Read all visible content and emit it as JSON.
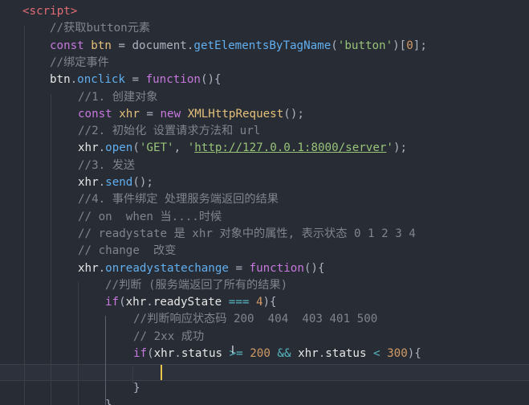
{
  "editor": {
    "lines": [
      {
        "tokens": [
          [
            "tag",
            "<script"
          ],
          [
            "tag",
            ">"
          ]
        ]
      },
      {
        "tokens": [
          [
            "cmt",
            "//获取button元素"
          ]
        ]
      },
      {
        "tokens": [
          [
            "kw",
            "const"
          ],
          [
            "plain",
            " "
          ],
          [
            "var",
            "btn"
          ],
          [
            "plain",
            " = "
          ],
          [
            "plain",
            "document"
          ],
          [
            "plain",
            "."
          ],
          [
            "fn",
            "getElementsByTagName"
          ],
          [
            "plain",
            "("
          ],
          [
            "str",
            "'button'"
          ],
          [
            "plain",
            ")["
          ],
          [
            "num",
            "0"
          ],
          [
            "plain",
            "];"
          ]
        ]
      },
      {
        "tokens": [
          [
            "cmt",
            "//绑定事件"
          ]
        ]
      },
      {
        "tokens": [
          [
            "txt",
            "btn"
          ],
          [
            "plain",
            "."
          ],
          [
            "fn",
            "onclick"
          ],
          [
            "plain",
            " = "
          ],
          [
            "kw",
            "function"
          ],
          [
            "plain",
            "(){"
          ]
        ]
      },
      {
        "tokens": [
          [
            "cmt",
            "//1. 创建对象"
          ]
        ]
      },
      {
        "tokens": [
          [
            "kw",
            "const"
          ],
          [
            "plain",
            " "
          ],
          [
            "var",
            "xhr"
          ],
          [
            "plain",
            " = "
          ],
          [
            "kw",
            "new"
          ],
          [
            "plain",
            " "
          ],
          [
            "cls",
            "XMLHttpRequest"
          ],
          [
            "plain",
            "();"
          ]
        ]
      },
      {
        "tokens": [
          [
            "cmt",
            "//2. 初始化 设置请求方法和 url"
          ]
        ]
      },
      {
        "tokens": [
          [
            "txt",
            "xhr"
          ],
          [
            "plain",
            "."
          ],
          [
            "fn",
            "open"
          ],
          [
            "plain",
            "("
          ],
          [
            "str",
            "'GET'"
          ],
          [
            "plain",
            ", "
          ],
          [
            "str",
            "'"
          ],
          [
            "url",
            "http://127.0.0.1:8000/server"
          ],
          [
            "str",
            "'"
          ],
          [
            "plain",
            ");"
          ]
        ]
      },
      {
        "tokens": [
          [
            "cmt",
            "//3. 发送"
          ]
        ]
      },
      {
        "tokens": [
          [
            "txt",
            "xhr"
          ],
          [
            "plain",
            "."
          ],
          [
            "fn",
            "send"
          ],
          [
            "plain",
            "();"
          ]
        ]
      },
      {
        "tokens": [
          [
            "cmt",
            "//4. 事件绑定 处理服务端返回的结果"
          ]
        ]
      },
      {
        "tokens": [
          [
            "cmt",
            "// on  when 当....时候"
          ]
        ]
      },
      {
        "tokens": [
          [
            "cmt",
            "// readystate 是 xhr 对象中的属性, 表示状态 0 1 2 3 4"
          ]
        ]
      },
      {
        "tokens": [
          [
            "cmt",
            "// change  改变"
          ]
        ]
      },
      {
        "tokens": [
          [
            "txt",
            "xhr"
          ],
          [
            "plain",
            "."
          ],
          [
            "fn",
            "onreadystatechange"
          ],
          [
            "plain",
            " = "
          ],
          [
            "kw",
            "function"
          ],
          [
            "plain",
            "(){"
          ]
        ]
      },
      {
        "tokens": [
          [
            "cmt",
            "//判断 (服务端返回了所有的结果)"
          ]
        ]
      },
      {
        "tokens": [
          [
            "kw",
            "if"
          ],
          [
            "plain",
            "("
          ],
          [
            "txt",
            "xhr"
          ],
          [
            "plain",
            "."
          ],
          [
            "txt",
            "readyState"
          ],
          [
            "plain",
            " "
          ],
          [
            "op",
            "==="
          ],
          [
            "plain",
            " "
          ],
          [
            "num",
            "4"
          ],
          [
            "plain",
            "){"
          ]
        ]
      },
      {
        "tokens": [
          [
            "cmt",
            "//判断响应状态码 200  404  403 401 500"
          ]
        ]
      },
      {
        "tokens": [
          [
            "cmt",
            "// 2xx 成功"
          ]
        ]
      },
      {
        "tokens": [
          [
            "kw",
            "if"
          ],
          [
            "plain",
            "("
          ],
          [
            "txt",
            "xhr"
          ],
          [
            "plain",
            "."
          ],
          [
            "txt",
            "status"
          ],
          [
            "plain",
            " "
          ],
          [
            "op",
            ">="
          ],
          [
            "plain",
            " "
          ],
          [
            "num",
            "200"
          ],
          [
            "plain",
            " "
          ],
          [
            "op",
            "&&"
          ],
          [
            "plain",
            " "
          ],
          [
            "txt",
            "xhr"
          ],
          [
            "plain",
            "."
          ],
          [
            "txt",
            "status"
          ],
          [
            "plain",
            " "
          ],
          [
            "op",
            "<"
          ],
          [
            "plain",
            " "
          ],
          [
            "num",
            "300"
          ],
          [
            "plain",
            "){"
          ]
        ]
      },
      {
        "tokens": [
          [
            "plain",
            ""
          ]
        ]
      },
      {
        "tokens": [
          [
            "plain",
            "}"
          ]
        ]
      },
      {
        "tokens": [
          [
            "plain",
            "}"
          ]
        ]
      }
    ]
  }
}
